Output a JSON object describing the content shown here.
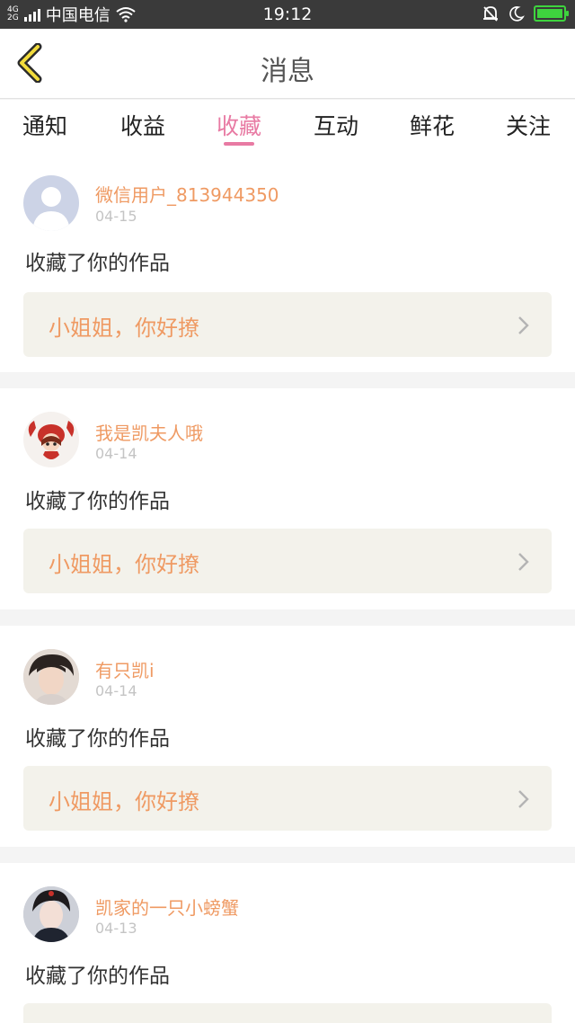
{
  "status_bar": {
    "network": "4G 2G",
    "carrier": "中国电信",
    "time": "19:12"
  },
  "nav": {
    "title": "消息"
  },
  "tabs": [
    {
      "label": "通知"
    },
    {
      "label": "收益"
    },
    {
      "label": "收藏"
    },
    {
      "label": "互动"
    },
    {
      "label": "鲜花"
    },
    {
      "label": "关注"
    }
  ],
  "active_tab": "收藏",
  "accent_color": "#e87aa3",
  "name_color": "#ef9a63",
  "messages": [
    {
      "username": "微信用户_813944350",
      "date": "04-15",
      "action": "收藏了你的作品",
      "work_title": "小姐姐，你好撩",
      "avatar_icon": "default-user-avatar"
    },
    {
      "username": "我是凯夫人哦",
      "date": "04-14",
      "action": "收藏了你的作品",
      "work_title": "小姐姐，你好撩",
      "avatar_icon": "cartoon-crab-avatar"
    },
    {
      "username": "有只凯i",
      "date": "04-14",
      "action": "收藏了你的作品",
      "work_title": "小姐姐，你好撩",
      "avatar_icon": "portrait-avatar"
    },
    {
      "username": "凯家的一只小螃蟹",
      "date": "04-13",
      "action": "收藏了你的作品",
      "work_title": "",
      "avatar_icon": "portrait-avatar"
    }
  ]
}
